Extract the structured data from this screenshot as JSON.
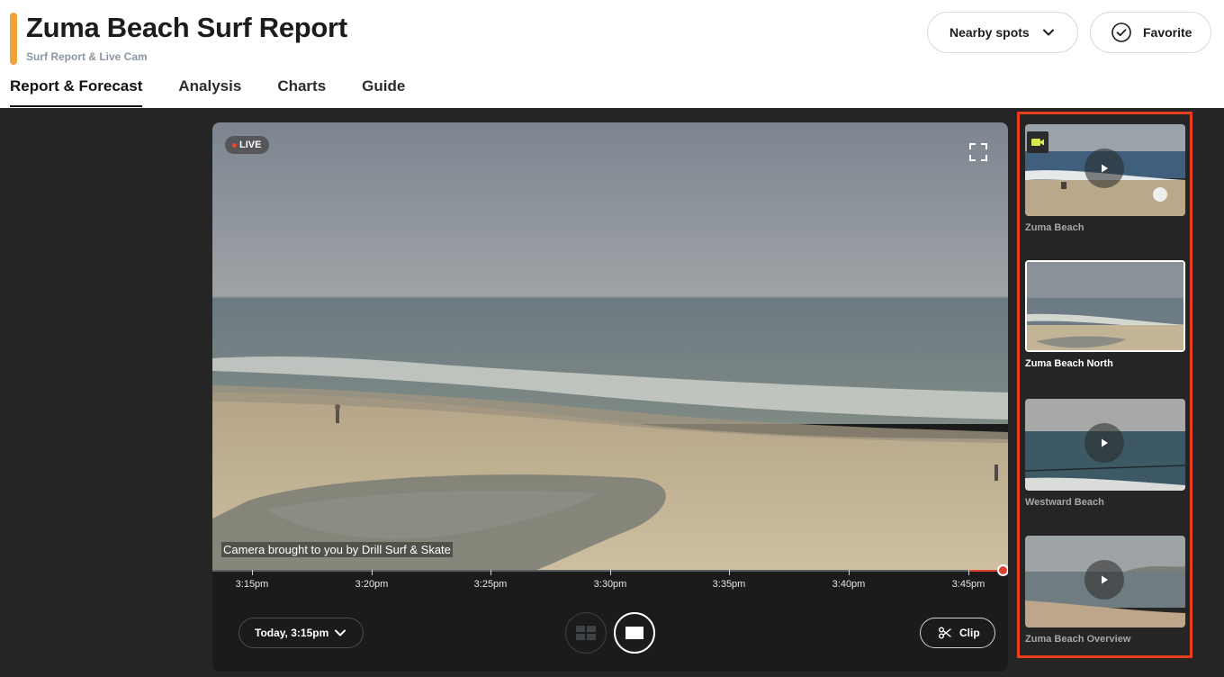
{
  "header": {
    "title": "Zuma Beach Surf Report",
    "subtitle": "Surf Report & Live Cam",
    "accent_color": "#f2a23a",
    "nearby_label": "Nearby spots",
    "favorite_label": "Favorite"
  },
  "tabs": [
    {
      "label": "Report & Forecast",
      "active": true
    },
    {
      "label": "Analysis",
      "active": false
    },
    {
      "label": "Charts",
      "active": false
    },
    {
      "label": "Guide",
      "active": false
    }
  ],
  "player": {
    "live_label": "LIVE",
    "sponsor_text": "Camera brought to you by Drill Surf & Skate",
    "timeline_ticks": [
      "3:15pm",
      "3:20pm",
      "3:25pm",
      "3:30pm",
      "3:35pm",
      "3:40pm",
      "3:45pm"
    ],
    "date_label": "Today, 3:15pm",
    "clip_label": "Clip",
    "view_mode": "single"
  },
  "cams": [
    {
      "label": "Zuma Beach",
      "selected": false,
      "icon": "video-camera-icon"
    },
    {
      "label": "Zuma Beach North",
      "selected": true,
      "icon": null
    },
    {
      "label": "Westward Beach",
      "selected": false,
      "icon": null
    },
    {
      "label": "Zuma Beach Overview",
      "selected": false,
      "icon": null
    }
  ],
  "colors": {
    "accent": "#f2a23a",
    "live_red": "#e0412f",
    "highlight_border": "#e8401f",
    "dark_bg": "#252525"
  }
}
